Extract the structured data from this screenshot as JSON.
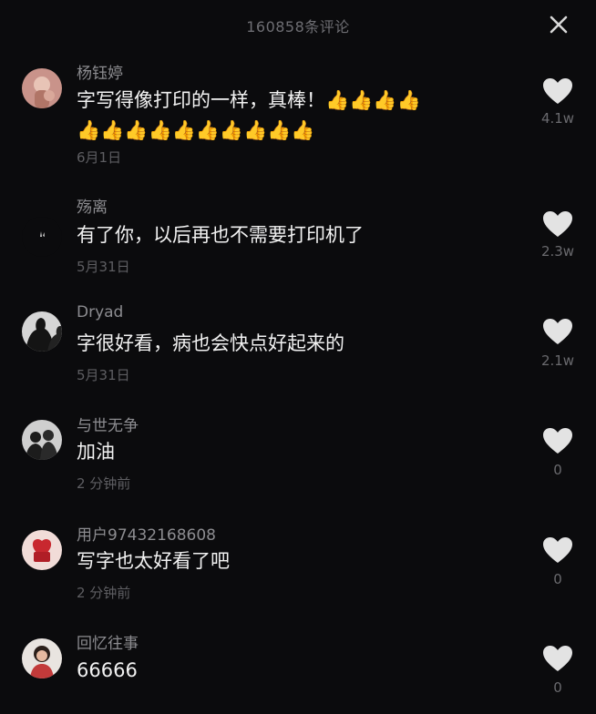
{
  "header": {
    "title": "160858条评论"
  },
  "comments": [
    {
      "username": "杨钰婷",
      "text_line1": "字写得像打印的一样，真棒！👍👍👍👍",
      "text_line2": "👍👍👍👍👍👍👍👍👍👍",
      "time": "6月1日",
      "likes": "4.1w"
    },
    {
      "username": "殇离",
      "text_line1": "有了你，以后再也不需要打印机了",
      "time": "5月31日",
      "likes": "2.3w"
    },
    {
      "username": "Dryad",
      "text_line1": "字很好看，病也会快点好起来的",
      "time": "5月31日",
      "likes": "2.1w"
    },
    {
      "username": "与世无争",
      "text_line1": "加油",
      "time": "2 分钟前",
      "likes": "0"
    },
    {
      "username": "用户97432168608",
      "text_line1": "写字也太好看了吧",
      "time": "2 分钟前",
      "likes": "0"
    },
    {
      "username": "回忆往事",
      "text_line1": "66666",
      "time": "",
      "likes": "0"
    }
  ],
  "icons": {
    "close": "close-icon",
    "like": "heart-icon"
  },
  "colors": {
    "background": "#0b0b0d",
    "username": "#8c8c90",
    "text": "#f2f2f2",
    "muted": "#5e5e62"
  }
}
